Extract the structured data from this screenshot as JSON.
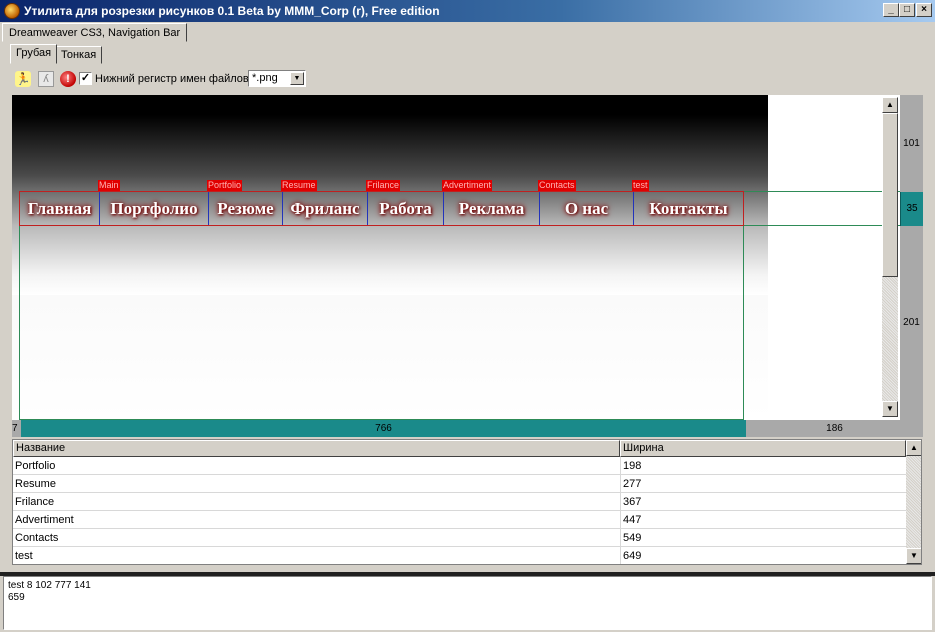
{
  "window": {
    "title": "Утилита для розрезки рисунков 0.1 Beta by MMM_Corp (r), Free edition",
    "buttons": {
      "minimize": "_",
      "maximize": "□",
      "close": "×"
    }
  },
  "doc_tab": {
    "label": "Dreamweaver CS3, Navigation Bar"
  },
  "mode_tabs": [
    {
      "label": "Грубая",
      "active": true
    },
    {
      "label": "Тонкая",
      "active": false
    }
  ],
  "toolbar": {
    "icons": [
      "run-icon",
      "walk-icon",
      "stop-icon"
    ],
    "lowercase_checkbox": {
      "label": "Нижний регистр имен файлов",
      "checked": true,
      "mark": "✓"
    },
    "format_combo": {
      "value": "*.png",
      "arrow": "▼"
    }
  },
  "nav_bar": {
    "items": [
      {
        "label": "Главная",
        "tag": ""
      },
      {
        "label": "Портфолио",
        "tag": "Main"
      },
      {
        "label": "Резюме",
        "tag": "Portfolio"
      },
      {
        "label": "Фриланс",
        "tag": "Resume"
      },
      {
        "label": "Работа",
        "tag": "Frilance"
      },
      {
        "label": "Реклама",
        "tag": "Advertiment"
      },
      {
        "label": "О нас",
        "tag": "Contacts"
      },
      {
        "label": "Контакты",
        "tag": "test"
      }
    ]
  },
  "vscroll": {
    "up": "▲",
    "down": "▼"
  },
  "side_ruler": {
    "segments": [
      "101",
      "35",
      "201"
    ]
  },
  "bottom_ruler": {
    "segments": [
      "7",
      "766",
      "186"
    ]
  },
  "slices_table": {
    "columns": [
      "Название",
      "Ширина"
    ],
    "rows": [
      {
        "name": "Portfolio",
        "width": "198"
      },
      {
        "name": "Resume",
        "width": "277"
      },
      {
        "name": "Frilance",
        "width": "367"
      },
      {
        "name": "Advertiment",
        "width": "447"
      },
      {
        "name": "Contacts",
        "width": "549"
      },
      {
        "name": "test",
        "width": "649"
      }
    ],
    "scroll": {
      "up": "▲",
      "down": "▼"
    }
  },
  "log": {
    "lines": [
      "test 8 102 777 141",
      "659"
    ]
  },
  "colors": {
    "title_gradient_start": "#0a246a",
    "ruler_teal": "#1a8a8a",
    "slice_border_red": "#c02020",
    "slice_border_blue": "#2233bb",
    "frame_green": "#2e8b57"
  }
}
